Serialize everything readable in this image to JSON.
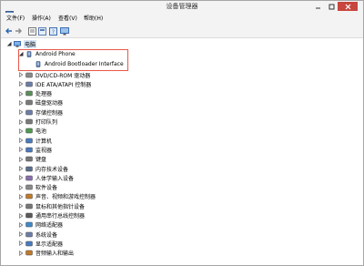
{
  "window": {
    "title": "设备管理器"
  },
  "menu": [
    "文件(F)",
    "操作(A)",
    "查看(V)",
    "帮助(H)"
  ],
  "toolbar_icons": [
    "back-arrow-icon",
    "forward-arrow-icon",
    "properties-icon",
    "view-icon",
    "help-icon",
    "monitor-icon"
  ],
  "tree": {
    "root": "电脑",
    "android_phone": "Android Phone",
    "bootloader": "Android Bootloader Interface",
    "categories": [
      "DVD/CD-ROM 驱动器",
      "IDE ATA/ATAPI 控制器",
      "处理器",
      "磁盘驱动器",
      "存储控制器",
      "打印队列",
      "电池",
      "计算机",
      "监视器",
      "键盘",
      "内存技术设备",
      "人体学输入设备",
      "软件设备",
      "声音、视频和游戏控制器",
      "鼠标和其他指针设备",
      "通用串行总线控制器",
      "网络适配器",
      "系统设备",
      "显示适配器",
      "音频输入和输出"
    ]
  },
  "colors": {
    "accent": "#e8584a",
    "close_button": "#c7463d",
    "selection": "#d5e6f7"
  }
}
